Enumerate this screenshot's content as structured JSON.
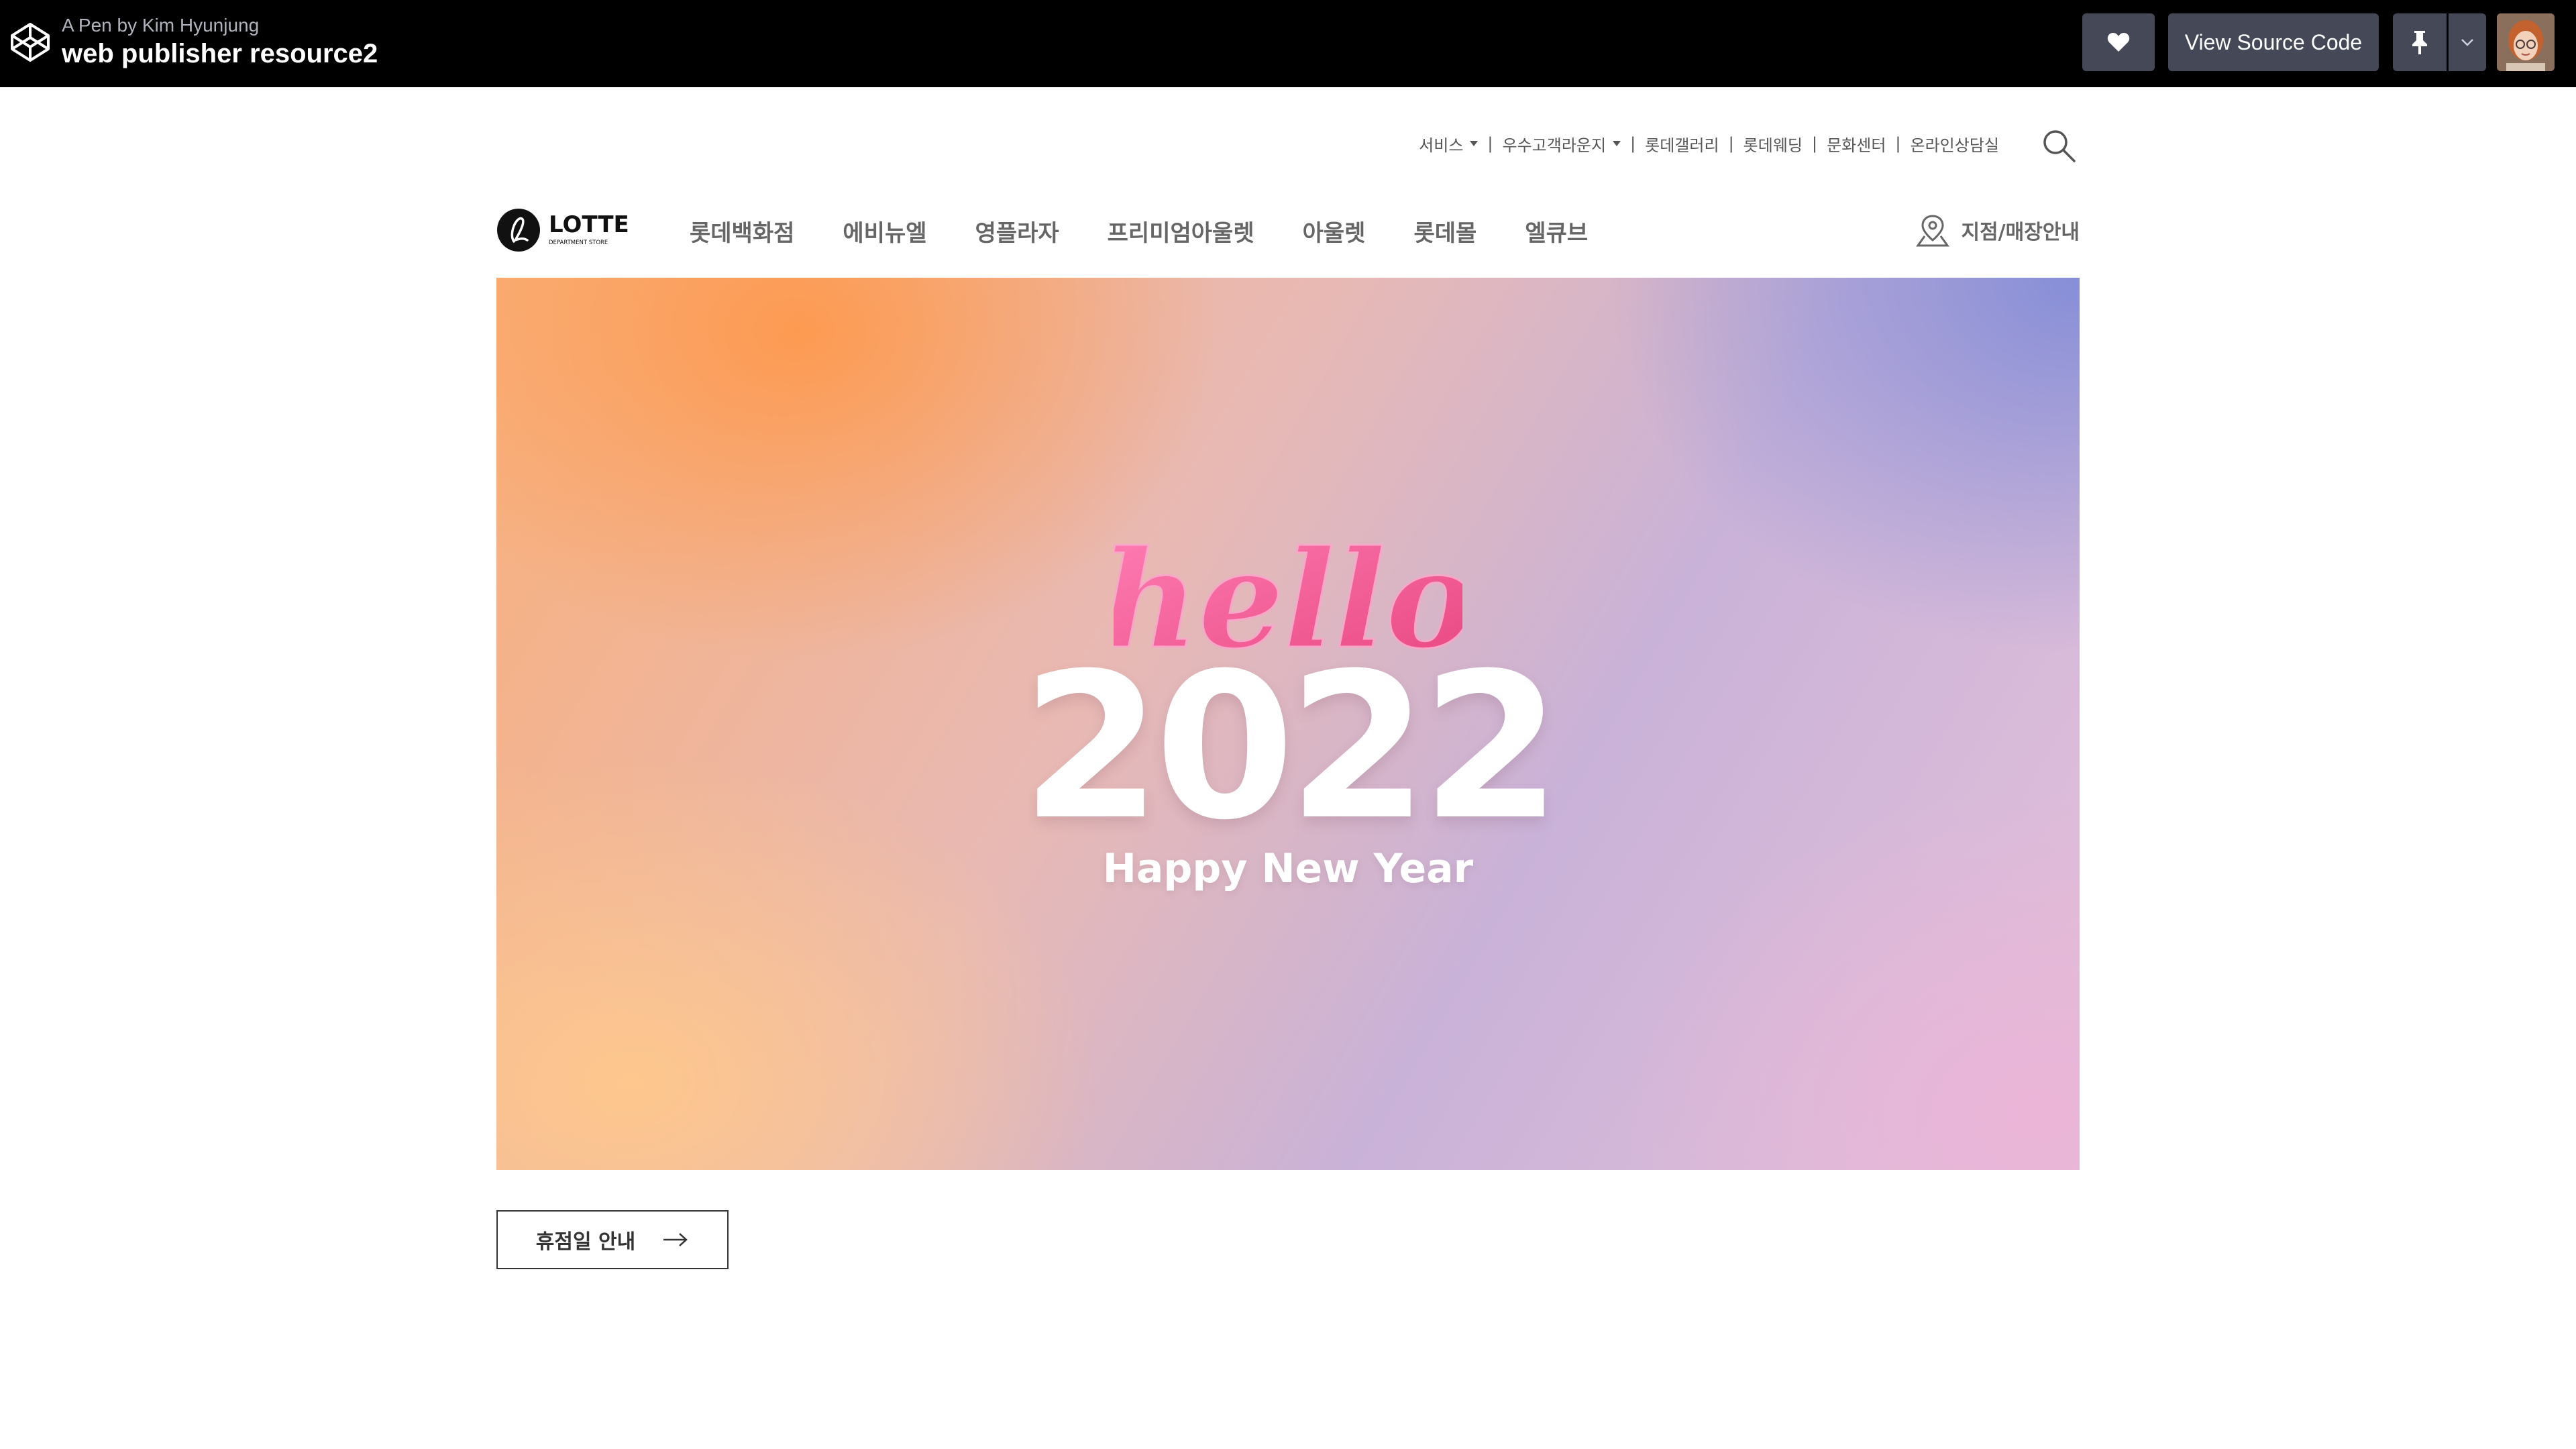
{
  "codepen": {
    "byline": "A Pen by Kim Hyunjung",
    "title": "web publisher resource2",
    "view_source_label": "View Source Code",
    "icons": [
      "codepen-logo-icon",
      "heart-icon",
      "pin-icon",
      "chevron-down-icon"
    ]
  },
  "util_menu": {
    "items": [
      {
        "label": "서비스",
        "dropdown": true
      },
      {
        "label": "우수고객라운지",
        "dropdown": true
      },
      {
        "label": "롯데갤러리"
      },
      {
        "label": "롯데웨딩"
      },
      {
        "label": "문화센터"
      },
      {
        "label": "온라인상담실"
      }
    ]
  },
  "header": {
    "logo_text": "LOTTE",
    "logo_sub": "DEPARTMENT STORE",
    "nav": [
      "롯데백화점",
      "에비뉴엘",
      "영플라자",
      "프리미엄아울렛",
      "아울렛",
      "롯데몰",
      "엘큐브"
    ],
    "store_link": "지점/매장안내"
  },
  "hero": {
    "script_text": "hello",
    "year": "2022",
    "subtitle": "Happy New Year"
  },
  "notice": {
    "label": "휴점일 안내"
  },
  "colors": {
    "topbar": "#000000",
    "button": "#444857",
    "text_gray": "#666666",
    "hello_pink": "#ef5c97"
  }
}
